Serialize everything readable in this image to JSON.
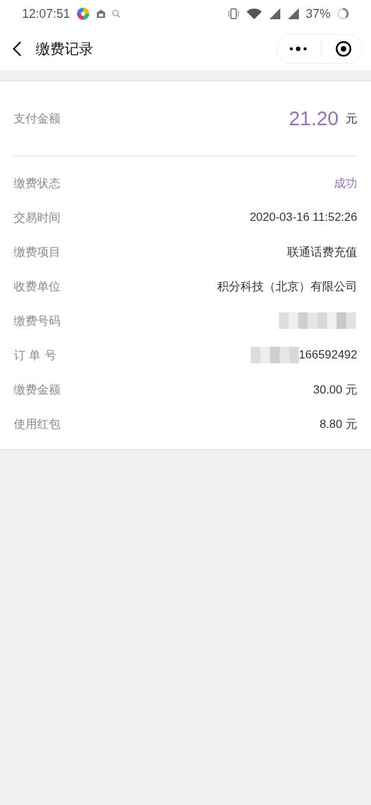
{
  "status_bar": {
    "time": "12:07:51",
    "battery": "37%"
  },
  "nav": {
    "title": "缴费记录"
  },
  "amount": {
    "label": "支付金额",
    "value": "21.20",
    "unit": "元"
  },
  "rows": [
    {
      "label": "缴费状态",
      "value": "成功",
      "kind": "status"
    },
    {
      "label": "交易时间",
      "value": "2020-03-16 11:52:26",
      "kind": "text"
    },
    {
      "label": "缴费项目",
      "value": "联通话费充值",
      "kind": "text"
    },
    {
      "label": "收费单位",
      "value": "积分科技（北京）有限公司",
      "kind": "text"
    },
    {
      "label": "缴费号码",
      "kind": "redacted"
    },
    {
      "label": "订 单 号",
      "value": "166592492",
      "kind": "partly_redacted"
    },
    {
      "label": "缴费金额",
      "value": "30.00 元",
      "kind": "text"
    },
    {
      "label": "使用红包",
      "value": "8.80 元",
      "kind": "text"
    }
  ]
}
